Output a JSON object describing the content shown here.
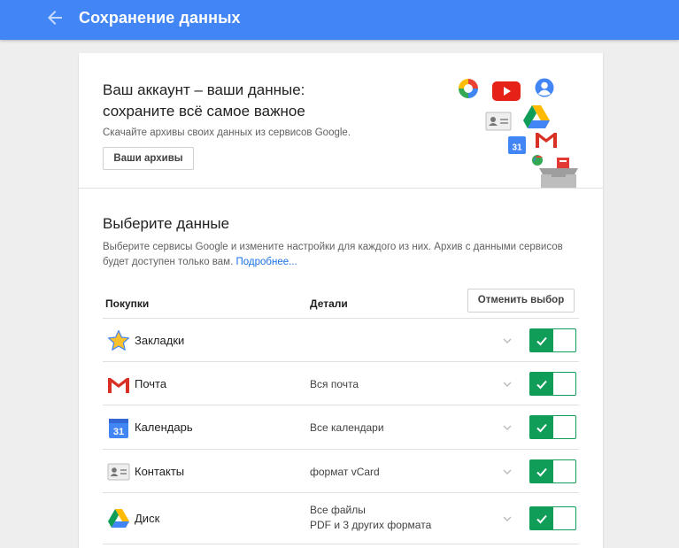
{
  "app_bar": {
    "title": "Сохранение данных",
    "back_icon": "arrow-back-icon"
  },
  "hero": {
    "title_line1": "Ваш аккаунт – ваши данные:",
    "title_line2": "сохраните всё самое важное",
    "description": "Скачайте архивы своих данных из сервисов Google.",
    "button_label": "Ваши архивы",
    "collage_icons": [
      "photos-icon",
      "youtube-icon",
      "profile-icon",
      "contacts-card-icon",
      "drive-icon",
      "calendar-icon",
      "gmail-icon",
      "hangouts-icon",
      "archive-box-icon"
    ],
    "calendar_day": "31"
  },
  "select": {
    "title": "Выберите данные",
    "description": "Выберите сервисы Google и измените настройки для каждого из них. Архив с данными сервисов будет доступен только вам. ",
    "more_link": "Подробнее..."
  },
  "table": {
    "col_products": "Покупки",
    "col_details": "Детали",
    "deselect_label": "Отменить выбор",
    "rows": [
      {
        "icon": "star-icon",
        "name": "Закладки",
        "details": "",
        "details_line2": "",
        "checked": true
      },
      {
        "icon": "gmail-icon",
        "name": "Почта",
        "details": "Вся почта",
        "details_line2": "",
        "checked": true
      },
      {
        "icon": "calendar-icon",
        "name": "Календарь",
        "details": "Все календари",
        "details_line2": "",
        "calendar_day": "31",
        "checked": true
      },
      {
        "icon": "contacts-card-icon",
        "name": "Контакты",
        "details": "формат vCard",
        "details_line2": "",
        "checked": true
      },
      {
        "icon": "drive-icon",
        "name": "Диск",
        "details": "Все файлы",
        "details_line2": "PDF и 3 других формата",
        "checked": true
      }
    ]
  },
  "colors": {
    "app_bar": "#4285f4",
    "toggle_on": "#0f9d58",
    "link": "#1a73e8",
    "background": "#eeeeee"
  }
}
